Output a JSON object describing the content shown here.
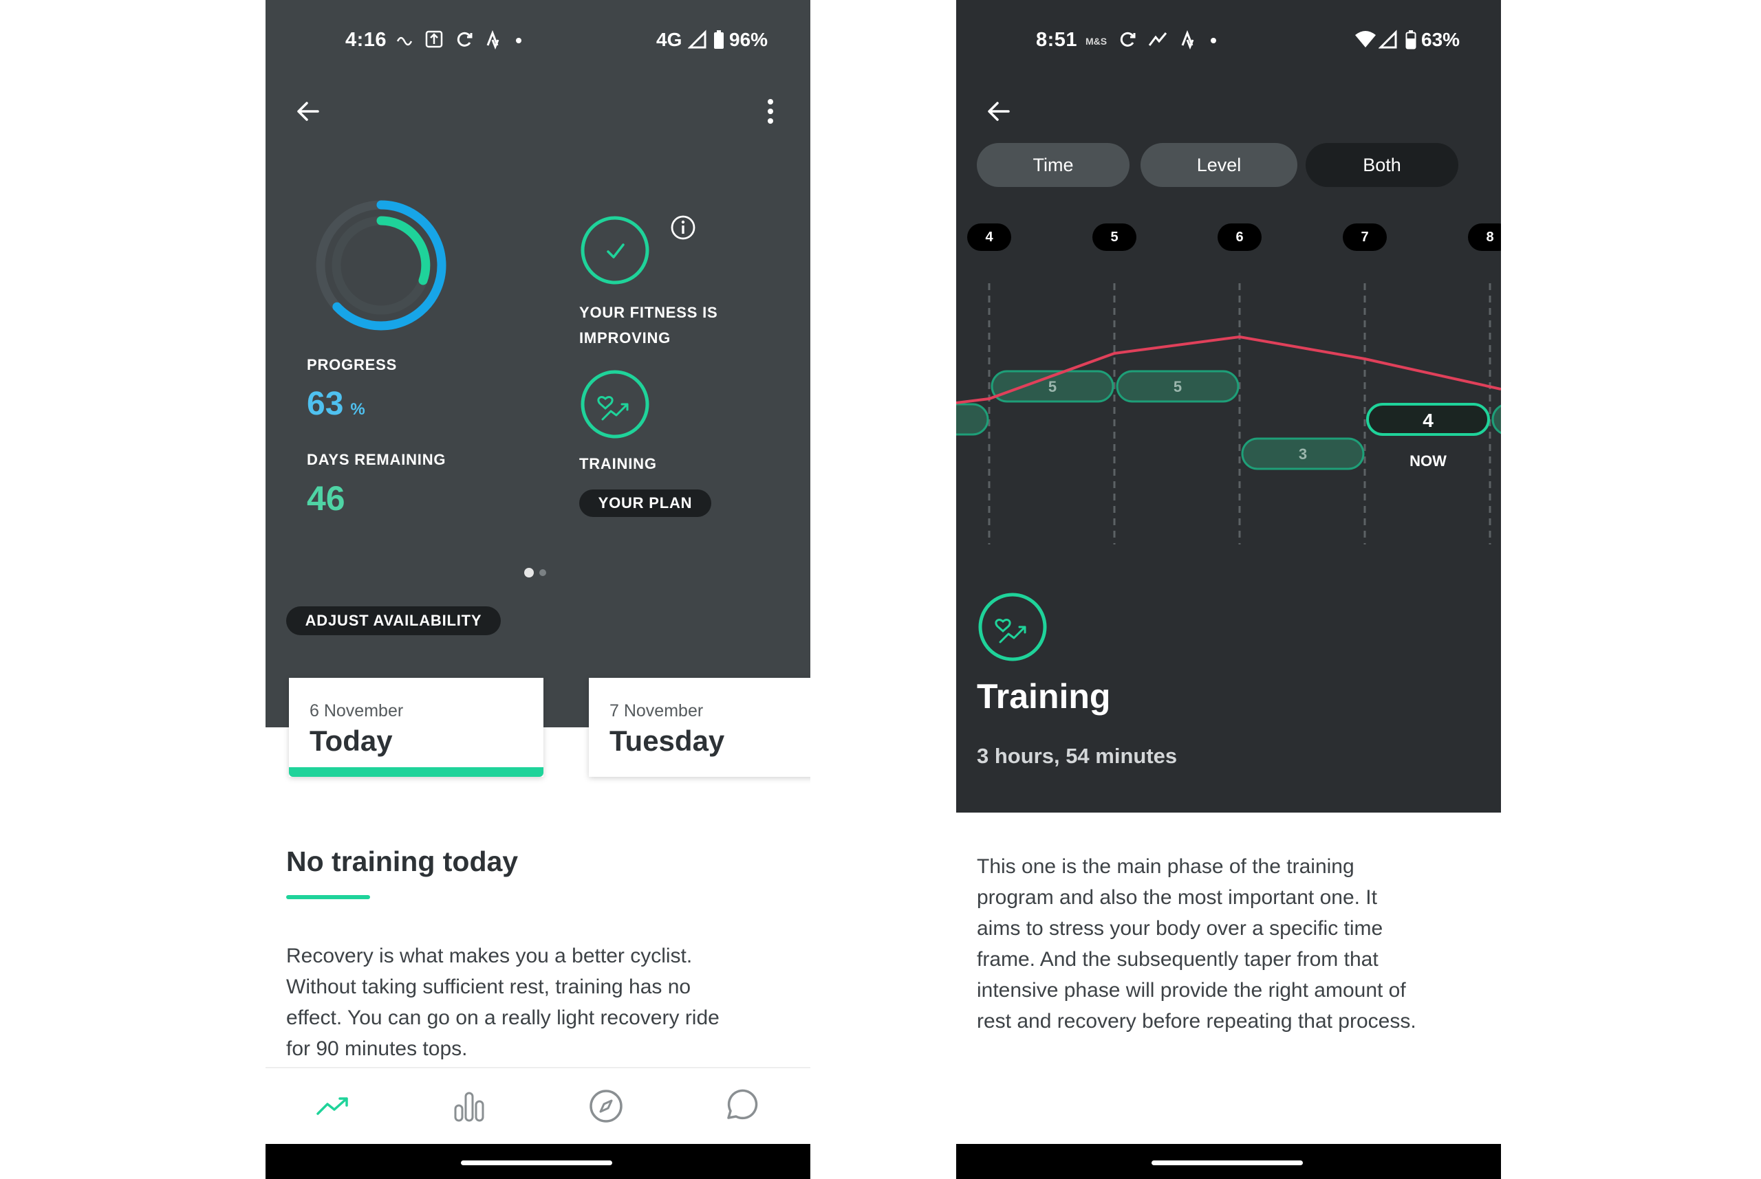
{
  "left": {
    "status": {
      "time": "4:16",
      "network": "4G",
      "battery": "96%"
    },
    "stats": {
      "progress_label": "PROGRESS",
      "progress_value": "63",
      "progress_unit": "%",
      "progress_fraction": 0.63,
      "days_label": "DAYS REMAINING",
      "days_value": "46"
    },
    "fitness": {
      "line1": "YOUR FITNESS IS",
      "line2": "IMPROVING"
    },
    "training": {
      "label": "TRAINING",
      "plan_button": "YOUR PLAN"
    },
    "carousel": {
      "pages": 2,
      "active": 1
    },
    "adjust_button": "ADJUST AVAILABILITY",
    "day_cards": [
      {
        "date": "6 November",
        "day": "Today",
        "selected": true
      },
      {
        "date": "7 November",
        "day": "Tuesday",
        "selected": false
      }
    ],
    "section_title": "No training today",
    "description": [
      "Recovery is what makes you a better cyclist.",
      "Without taking sufficient rest, training has no",
      "effect. You can go on a really light recovery ride",
      "for 90 minutes tops."
    ],
    "nav_icons": [
      "trend-icon",
      "bar-chart-icon",
      "compass-icon",
      "chat-icon"
    ],
    "accent": "#1fd39a",
    "ring_blue": "#17a5e8"
  },
  "right": {
    "status": {
      "time": "8:51",
      "badge": "M&S",
      "battery": "63%"
    },
    "segments": [
      {
        "label": "Time",
        "active": false
      },
      {
        "label": "Level",
        "active": false
      },
      {
        "label": "Both",
        "active": true
      }
    ],
    "weeks": [
      "4",
      "5",
      "6",
      "7",
      "8"
    ],
    "phases": [
      {
        "week": "4",
        "level": "5"
      },
      {
        "week": "5",
        "level": "5"
      },
      {
        "week": "6",
        "level": "3"
      },
      {
        "week": "7",
        "level": "4",
        "current": true
      }
    ],
    "now_label": "NOW",
    "title": "Training",
    "duration": "3 hours, 54 minutes",
    "description": [
      "This one is the main phase of the training",
      "program and also the most important one. It",
      "aims to stress your body over a specific time",
      "frame. And the subsequently taper from that",
      "intensive phase will provide the right amount of",
      "rest and recovery before repeating that process."
    ],
    "line_color": "#e0405a",
    "accent": "#1fd39a"
  }
}
